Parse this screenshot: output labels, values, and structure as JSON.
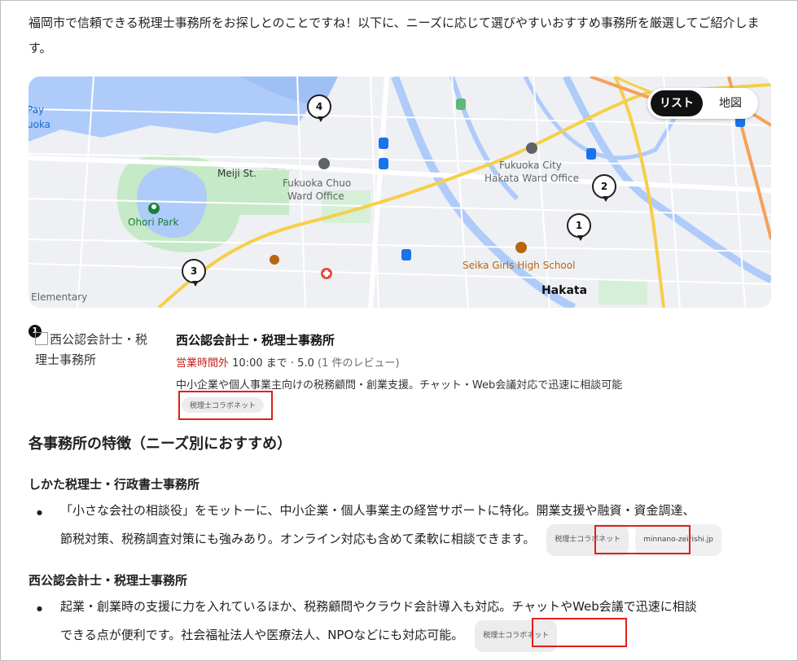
{
  "intro": "福岡市で信頼できる税理士事務所をお探しとのことですね！以下に、ニーズに応じて選びやすいおすすめ事務所を厳選してご紹介します。",
  "map": {
    "toggle": {
      "list": "リスト",
      "map": "地図"
    },
    "labels": {
      "meiji": "Meiji St.",
      "chuo1": "Fukuoka Chuo",
      "chuo2": "Ward Office",
      "ohori": "Ohori Park",
      "hakata_ward1": "Fukuoka City",
      "hakata_ward2": "Hakata Ward Office",
      "seika": "Seika Girls High School",
      "hakata": "Hakata",
      "elementary": "i Elementary",
      "pay1": "Pay",
      "pay2": "uoka"
    },
    "pins": [
      "1",
      "2",
      "3",
      "4"
    ],
    "icons": [
      "pin-marker-icon",
      "park-icon",
      "school-icon",
      "hospital-icon",
      "train-icon",
      "government-icon"
    ]
  },
  "listing": {
    "number": "1",
    "image_alt": "西公認会計士・税理士事務所",
    "title": "西公認会計士・税理士事務所",
    "status": "営業時間外",
    "hours": "10:00 まで",
    "rating": "5.0",
    "reviews": "(1 件のレビュー)",
    "description": "中小企業や個人事業主向けの税務顧問・創業支援。チャット・Web会議対応で迅速に相談可能",
    "source_chip": "税理士コラボネット"
  },
  "section": {
    "heading": "各事務所の特徴（ニーズ別におすすめ）",
    "items": [
      {
        "title": "しかた税理士・行政書士事務所",
        "line1": "「小さな会社の相談役」をモットーに、中小企業・個人事業主の経営サポートに特化。開業支援や融資・資金調達、",
        "line2": "節税対策、税務調査対策にも強みあり。オンライン対応も含めて柔軟に相談できます。",
        "chip": "税理士コラボネット",
        "chip2": "minnano-zeirishi.jp"
      },
      {
        "title": "西公認会計士・税理士事務所",
        "line1": "起業・創業時の支援に力を入れているほか、税務顧問やクラウド会計導入も対応。チャットやWeb会議で迅速に相談",
        "line2": "できる点が便利です。社会福祉法人や医療法人、NPOなどにも対応可能。",
        "chip": "税理士コラボネット"
      }
    ]
  },
  "colors": {
    "highlight_box": "#e0201b",
    "closed": "#c5221f",
    "park": "#198039",
    "road": "#f6cf4a",
    "water": "#aecbfa"
  }
}
